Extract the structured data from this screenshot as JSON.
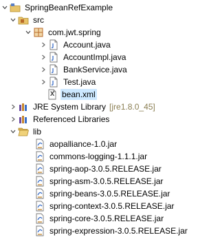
{
  "tree": {
    "project": {
      "label": "SpringBeanRefExample"
    },
    "src": {
      "label": "src"
    },
    "package": {
      "label": "com.jwt.spring"
    },
    "java_files": [
      "Account.java",
      "AccountImpl.java",
      "BankService.java",
      "Test.java"
    ],
    "bean_xml": {
      "label": "bean.xml",
      "icon_letter": "X"
    },
    "jre": {
      "label": "JRE System Library",
      "decoration": "[jre1.8.0_45]"
    },
    "referenced": {
      "label": "Referenced Libraries"
    },
    "lib": {
      "label": "lib"
    },
    "jars": [
      "aopalliance-1.0.jar",
      "commons-logging-1.1.1.jar",
      "spring-aop-3.0.5.RELEASE.jar",
      "spring-asm-3.0.5.RELEASE.jar",
      "spring-beans-3.0.5.RELEASE.jar",
      "spring-context-3.0.5.RELEASE.jar",
      "spring-core-3.0.5.RELEASE.jar",
      "spring-expression-3.0.5.RELEASE.jar"
    ]
  },
  "colors": {
    "selection": "#cce8ff",
    "folder": "#e8c46a",
    "package": "#b86a2a",
    "decoration": "#8a7e52"
  }
}
